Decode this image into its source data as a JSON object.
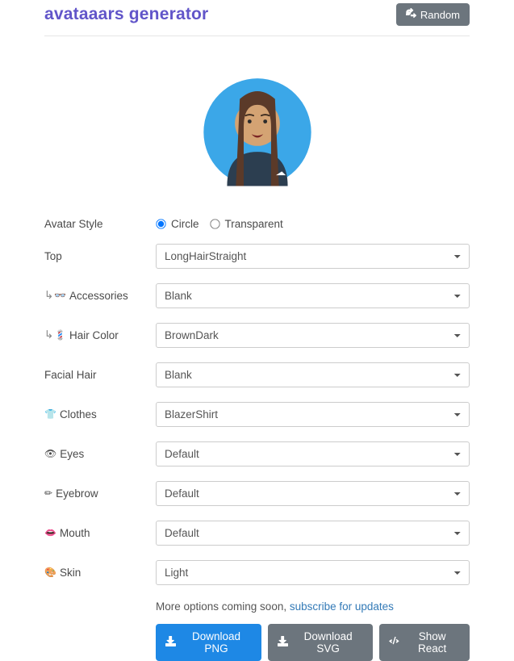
{
  "header": {
    "title": "avataaars generator",
    "random_label": "Random"
  },
  "avatar_style": {
    "label": "Avatar Style",
    "options": {
      "circle": "Circle",
      "transparent": "Transparent"
    },
    "selected": "circle"
  },
  "fields": {
    "top": {
      "label": "Top",
      "value": "LongHairStraight",
      "prefix": "",
      "emoji": ""
    },
    "accessories": {
      "label": "Accessories",
      "value": "Blank",
      "prefix": "↳",
      "emoji": "👓"
    },
    "hair_color": {
      "label": "Hair Color",
      "value": "BrownDark",
      "prefix": "↳",
      "emoji": "💈"
    },
    "facial_hair": {
      "label": "Facial Hair",
      "value": "Blank",
      "prefix": "",
      "emoji": ""
    },
    "clothes": {
      "label": "Clothes",
      "value": "BlazerShirt",
      "prefix": "",
      "emoji": "👕"
    },
    "eyes": {
      "label": "Eyes",
      "value": "Default",
      "prefix": "",
      "emoji": "👁"
    },
    "eyebrow": {
      "label": "Eyebrow",
      "value": "Default",
      "prefix": "",
      "emoji": "✏"
    },
    "mouth": {
      "label": "Mouth",
      "value": "Default",
      "prefix": "",
      "emoji": "👄"
    },
    "skin": {
      "label": "Skin",
      "value": "Light",
      "prefix": "",
      "emoji": "🎨"
    }
  },
  "footer": {
    "hint_text": "More options coming soon, ",
    "hint_link": "subscribe for updates",
    "download_png": "Download PNG",
    "download_svg": "Download SVG",
    "show_react": "Show React"
  }
}
